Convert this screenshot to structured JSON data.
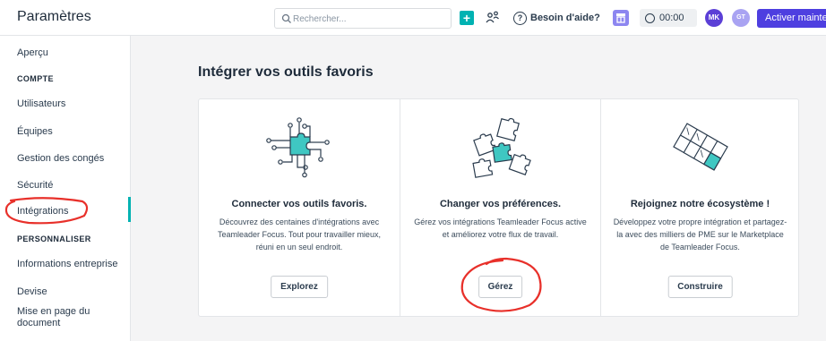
{
  "header": {
    "title": "Paramètres",
    "search_placeholder": "Rechercher...",
    "plus_label": "+",
    "help_label": "Besoin d'aide?",
    "help_icon_glyph": "?",
    "timer_value": "00:00",
    "logo_initials": "MK",
    "avatar_initials": "GT",
    "activate_label": "Activer mainte"
  },
  "sidebar": {
    "items": [
      {
        "label": "Aperçu",
        "type": "item"
      },
      {
        "label": "COMPTE",
        "type": "heading"
      },
      {
        "label": "Utilisateurs",
        "type": "item"
      },
      {
        "label": "Équipes",
        "type": "item"
      },
      {
        "label": "Gestion des congés",
        "type": "item"
      },
      {
        "label": "Sécurité",
        "type": "item"
      },
      {
        "label": "Intégrations",
        "type": "item",
        "active": true
      },
      {
        "label": "PERSONNALISER",
        "type": "heading"
      },
      {
        "label": "Informations entreprise",
        "type": "item"
      },
      {
        "label": "Devise",
        "type": "item"
      },
      {
        "label": "Mise en page du document",
        "type": "item"
      }
    ]
  },
  "main": {
    "title": "Intégrer vos outils favoris",
    "cards": [
      {
        "icon": "connector-puzzle-icon",
        "title": "Connecter vos outils favoris.",
        "description": "Découvrez des centaines d'intégrations avec Teamleader Focus. Tout pour travailler mieux, réuni en un seul endroit.",
        "button": "Explorez"
      },
      {
        "icon": "scattered-puzzle-pieces-icon",
        "title": "Changer vos préférences.",
        "description": "Gérez vos intégrations Teamleader Focus active et améliorez votre flux de travail.",
        "button": "Gérez"
      },
      {
        "icon": "puzzle-ecosystem-icon",
        "title": "Rejoignez notre écosystème !",
        "description": "Développez votre propre intégration et partagez-la avec des milliers de PME sur le Marketplace de Teamleader Focus.",
        "button": "Construire"
      }
    ]
  },
  "colors": {
    "accent_teal": "#00b2b2",
    "primary_purple": "#4e3fe0",
    "annotation_red": "#e8302a"
  }
}
